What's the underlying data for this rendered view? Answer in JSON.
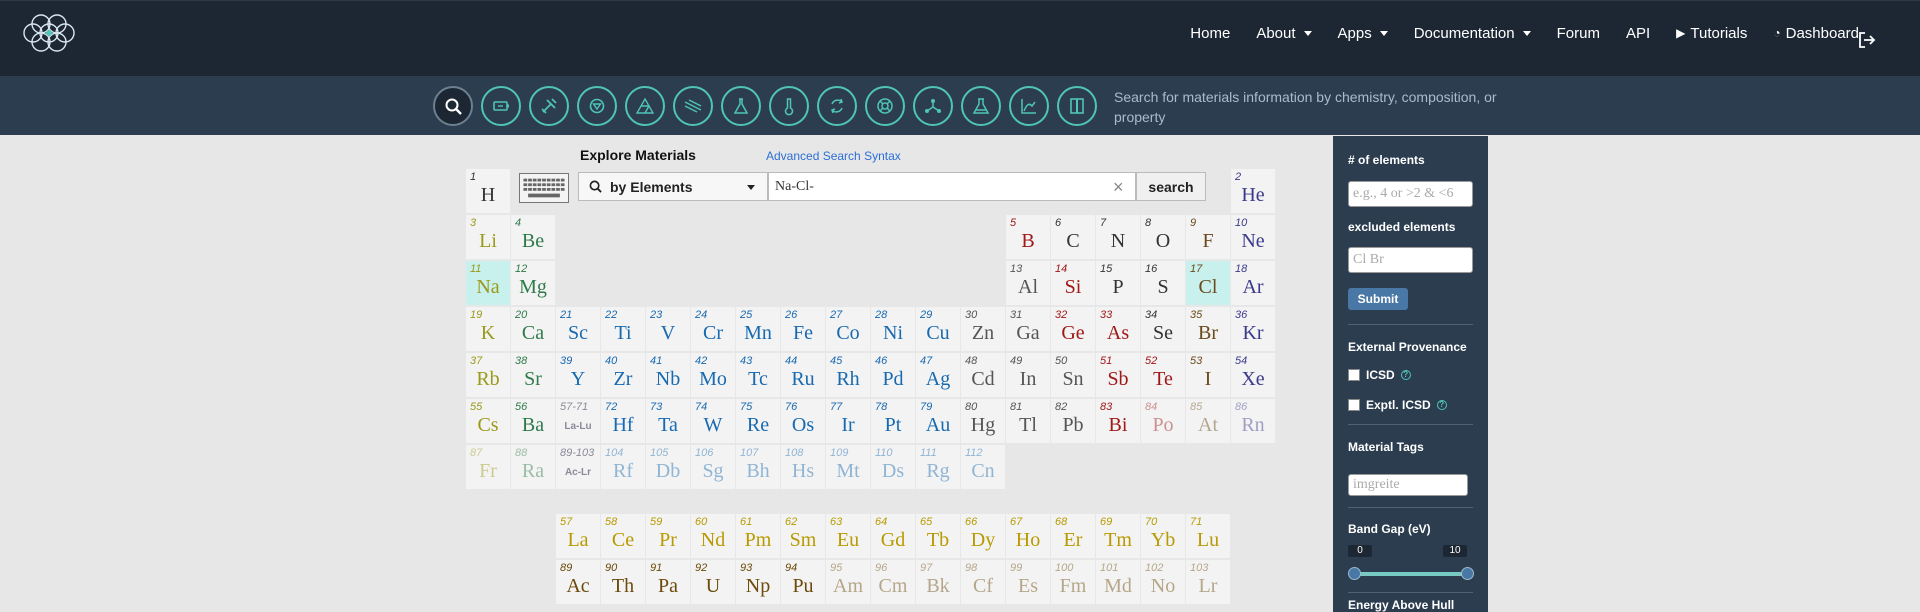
{
  "nav": {
    "items": [
      {
        "label": "Home",
        "caret": false,
        "icon": ""
      },
      {
        "label": "About",
        "caret": true,
        "icon": ""
      },
      {
        "label": "Apps",
        "caret": true,
        "icon": ""
      },
      {
        "label": "Documentation",
        "caret": true,
        "icon": ""
      },
      {
        "label": "Forum",
        "caret": false,
        "icon": ""
      },
      {
        "label": "API",
        "caret": false,
        "icon": ""
      },
      {
        "label": "Tutorials",
        "caret": false,
        "icon": "youtube-icon"
      },
      {
        "label": "Dashboard",
        "caret": false,
        "icon": "dashboard-icon"
      }
    ]
  },
  "toolbar": {
    "tools": [
      "search-icon",
      "battery-icon",
      "tools-icon",
      "shield-icon",
      "triangle-diagram-icon",
      "wave-icon",
      "flask-icon",
      "thermometer-icon",
      "cycle-icon",
      "lifebuoy-icon",
      "molecule-icon",
      "beaker-icon",
      "phase-plot-icon",
      "book-icon"
    ],
    "description": "Search for materials information by chemistry, composition, or property"
  },
  "explore": {
    "title": "Explore Materials",
    "advanced_link": "Advanced Search Syntax",
    "search_by": "by Elements",
    "query": "Na-Cl-",
    "search_button": "search"
  },
  "colors": {
    "nav_bg": "#1c2733",
    "toolbar_bg": "#2b3d4f",
    "accent": "#4fc4b8",
    "selected_element": "#c8f0ec",
    "submit": "#4a78a6"
  },
  "elements": [
    {
      "n": "1",
      "s": "H",
      "row": 1,
      "col": 1,
      "c": "nonmetal"
    },
    {
      "n": "2",
      "s": "He",
      "row": 1,
      "col": 18,
      "c": "noble"
    },
    {
      "n": "3",
      "s": "Li",
      "row": 2,
      "col": 1,
      "c": "alkali"
    },
    {
      "n": "4",
      "s": "Be",
      "row": 2,
      "col": 2,
      "c": "alkearth"
    },
    {
      "n": "5",
      "s": "B",
      "row": 2,
      "col": 13,
      "c": "metalloid"
    },
    {
      "n": "6",
      "s": "C",
      "row": 2,
      "col": 14,
      "c": "nonmetal"
    },
    {
      "n": "7",
      "s": "N",
      "row": 2,
      "col": 15,
      "c": "nonmetal"
    },
    {
      "n": "8",
      "s": "O",
      "row": 2,
      "col": 16,
      "c": "nonmetal"
    },
    {
      "n": "9",
      "s": "F",
      "row": 2,
      "col": 17,
      "c": "halogen"
    },
    {
      "n": "10",
      "s": "Ne",
      "row": 2,
      "col": 18,
      "c": "noble"
    },
    {
      "n": "11",
      "s": "Na",
      "row": 3,
      "col": 1,
      "c": "alkali",
      "sel": true
    },
    {
      "n": "12",
      "s": "Mg",
      "row": 3,
      "col": 2,
      "c": "alkearth"
    },
    {
      "n": "13",
      "s": "Al",
      "row": 3,
      "col": 13,
      "c": "post"
    },
    {
      "n": "14",
      "s": "Si",
      "row": 3,
      "col": 14,
      "c": "metalloid"
    },
    {
      "n": "15",
      "s": "P",
      "row": 3,
      "col": 15,
      "c": "nonmetal"
    },
    {
      "n": "16",
      "s": "S",
      "row": 3,
      "col": 16,
      "c": "nonmetal"
    },
    {
      "n": "17",
      "s": "Cl",
      "row": 3,
      "col": 17,
      "c": "halogen",
      "sel": true
    },
    {
      "n": "18",
      "s": "Ar",
      "row": 3,
      "col": 18,
      "c": "noble"
    },
    {
      "n": "19",
      "s": "K",
      "row": 4,
      "col": 1,
      "c": "alkali"
    },
    {
      "n": "20",
      "s": "Ca",
      "row": 4,
      "col": 2,
      "c": "alkearth"
    },
    {
      "n": "21",
      "s": "Sc",
      "row": 4,
      "col": 3,
      "c": "trans"
    },
    {
      "n": "22",
      "s": "Ti",
      "row": 4,
      "col": 4,
      "c": "trans"
    },
    {
      "n": "23",
      "s": "V",
      "row": 4,
      "col": 5,
      "c": "trans"
    },
    {
      "n": "24",
      "s": "Cr",
      "row": 4,
      "col": 6,
      "c": "trans"
    },
    {
      "n": "25",
      "s": "Mn",
      "row": 4,
      "col": 7,
      "c": "trans"
    },
    {
      "n": "26",
      "s": "Fe",
      "row": 4,
      "col": 8,
      "c": "trans"
    },
    {
      "n": "27",
      "s": "Co",
      "row": 4,
      "col": 9,
      "c": "trans"
    },
    {
      "n": "28",
      "s": "Ni",
      "row": 4,
      "col": 10,
      "c": "trans"
    },
    {
      "n": "29",
      "s": "Cu",
      "row": 4,
      "col": 11,
      "c": "trans"
    },
    {
      "n": "30",
      "s": "Zn",
      "row": 4,
      "col": 12,
      "c": "post"
    },
    {
      "n": "31",
      "s": "Ga",
      "row": 4,
      "col": 13,
      "c": "post"
    },
    {
      "n": "32",
      "s": "Ge",
      "row": 4,
      "col": 14,
      "c": "metalloid"
    },
    {
      "n": "33",
      "s": "As",
      "row": 4,
      "col": 15,
      "c": "metalloid"
    },
    {
      "n": "34",
      "s": "Se",
      "row": 4,
      "col": 16,
      "c": "nonmetal"
    },
    {
      "n": "35",
      "s": "Br",
      "row": 4,
      "col": 17,
      "c": "halogen"
    },
    {
      "n": "36",
      "s": "Kr",
      "row": 4,
      "col": 18,
      "c": "noble"
    },
    {
      "n": "37",
      "s": "Rb",
      "row": 5,
      "col": 1,
      "c": "alkali"
    },
    {
      "n": "38",
      "s": "Sr",
      "row": 5,
      "col": 2,
      "c": "alkearth"
    },
    {
      "n": "39",
      "s": "Y",
      "row": 5,
      "col": 3,
      "c": "trans"
    },
    {
      "n": "40",
      "s": "Zr",
      "row": 5,
      "col": 4,
      "c": "trans"
    },
    {
      "n": "41",
      "s": "Nb",
      "row": 5,
      "col": 5,
      "c": "trans"
    },
    {
      "n": "42",
      "s": "Mo",
      "row": 5,
      "col": 6,
      "c": "trans"
    },
    {
      "n": "43",
      "s": "Tc",
      "row": 5,
      "col": 7,
      "c": "trans"
    },
    {
      "n": "44",
      "s": "Ru",
      "row": 5,
      "col": 8,
      "c": "trans"
    },
    {
      "n": "45",
      "s": "Rh",
      "row": 5,
      "col": 9,
      "c": "trans"
    },
    {
      "n": "46",
      "s": "Pd",
      "row": 5,
      "col": 10,
      "c": "trans"
    },
    {
      "n": "47",
      "s": "Ag",
      "row": 5,
      "col": 11,
      "c": "trans"
    },
    {
      "n": "48",
      "s": "Cd",
      "row": 5,
      "col": 12,
      "c": "post"
    },
    {
      "n": "49",
      "s": "In",
      "row": 5,
      "col": 13,
      "c": "post"
    },
    {
      "n": "50",
      "s": "Sn",
      "row": 5,
      "col": 14,
      "c": "post"
    },
    {
      "n": "51",
      "s": "Sb",
      "row": 5,
      "col": 15,
      "c": "metalloid"
    },
    {
      "n": "52",
      "s": "Te",
      "row": 5,
      "col": 16,
      "c": "metalloid"
    },
    {
      "n": "53",
      "s": "I",
      "row": 5,
      "col": 17,
      "c": "halogen"
    },
    {
      "n": "54",
      "s": "Xe",
      "row": 5,
      "col": 18,
      "c": "noble"
    },
    {
      "n": "55",
      "s": "Cs",
      "row": 6,
      "col": 1,
      "c": "alkali"
    },
    {
      "n": "56",
      "s": "Ba",
      "row": 6,
      "col": 2,
      "c": "alkearth"
    },
    {
      "n": "57-71",
      "s": "La-Lu",
      "row": 6,
      "col": 3,
      "c": "ph",
      "small": true
    },
    {
      "n": "72",
      "s": "Hf",
      "row": 6,
      "col": 4,
      "c": "trans"
    },
    {
      "n": "73",
      "s": "Ta",
      "row": 6,
      "col": 5,
      "c": "trans"
    },
    {
      "n": "74",
      "s": "W",
      "row": 6,
      "col": 6,
      "c": "trans"
    },
    {
      "n": "75",
      "s": "Re",
      "row": 6,
      "col": 7,
      "c": "trans"
    },
    {
      "n": "76",
      "s": "Os",
      "row": 6,
      "col": 8,
      "c": "trans"
    },
    {
      "n": "77",
      "s": "Ir",
      "row": 6,
      "col": 9,
      "c": "trans"
    },
    {
      "n": "78",
      "s": "Pt",
      "row": 6,
      "col": 10,
      "c": "trans"
    },
    {
      "n": "79",
      "s": "Au",
      "row": 6,
      "col": 11,
      "c": "trans"
    },
    {
      "n": "80",
      "s": "Hg",
      "row": 6,
      "col": 12,
      "c": "post"
    },
    {
      "n": "81",
      "s": "Tl",
      "row": 6,
      "col": 13,
      "c": "post"
    },
    {
      "n": "82",
      "s": "Pb",
      "row": 6,
      "col": 14,
      "c": "post"
    },
    {
      "n": "83",
      "s": "Bi",
      "row": 6,
      "col": 15,
      "c": "metalloid"
    },
    {
      "n": "84",
      "s": "Po",
      "row": 6,
      "col": 16,
      "c": "metalloid",
      "faded": true
    },
    {
      "n": "85",
      "s": "At",
      "row": 6,
      "col": 17,
      "c": "halogen",
      "faded": true
    },
    {
      "n": "86",
      "s": "Rn",
      "row": 6,
      "col": 18,
      "c": "noble",
      "faded": true
    },
    {
      "n": "87",
      "s": "Fr",
      "row": 7,
      "col": 1,
      "c": "alkali",
      "faded": true
    },
    {
      "n": "88",
      "s": "Ra",
      "row": 7,
      "col": 2,
      "c": "alkearth",
      "faded": true
    },
    {
      "n": "89-103",
      "s": "Ac-Lr",
      "row": 7,
      "col": 3,
      "c": "ph",
      "small": true
    },
    {
      "n": "104",
      "s": "Rf",
      "row": 7,
      "col": 4,
      "c": "trans",
      "faded": true
    },
    {
      "n": "105",
      "s": "Db",
      "row": 7,
      "col": 5,
      "c": "trans",
      "faded": true
    },
    {
      "n": "106",
      "s": "Sg",
      "row": 7,
      "col": 6,
      "c": "trans",
      "faded": true
    },
    {
      "n": "107",
      "s": "Bh",
      "row": 7,
      "col": 7,
      "c": "trans",
      "faded": true
    },
    {
      "n": "108",
      "s": "Hs",
      "row": 7,
      "col": 8,
      "c": "trans",
      "faded": true
    },
    {
      "n": "109",
      "s": "Mt",
      "row": 7,
      "col": 9,
      "c": "trans",
      "faded": true
    },
    {
      "n": "110",
      "s": "Ds",
      "row": 7,
      "col": 10,
      "c": "trans",
      "faded": true
    },
    {
      "n": "111",
      "s": "Rg",
      "row": 7,
      "col": 11,
      "c": "trans",
      "faded": true
    },
    {
      "n": "112",
      "s": "Cn",
      "row": 7,
      "col": 12,
      "c": "trans",
      "faded": true
    },
    {
      "n": "57",
      "s": "La",
      "row": 8,
      "col": 3,
      "c": "lanth"
    },
    {
      "n": "58",
      "s": "Ce",
      "row": 8,
      "col": 4,
      "c": "lanth"
    },
    {
      "n": "59",
      "s": "Pr",
      "row": 8,
      "col": 5,
      "c": "lanth"
    },
    {
      "n": "60",
      "s": "Nd",
      "row": 8,
      "col": 6,
      "c": "lanth"
    },
    {
      "n": "61",
      "s": "Pm",
      "row": 8,
      "col": 7,
      "c": "lanth"
    },
    {
      "n": "62",
      "s": "Sm",
      "row": 8,
      "col": 8,
      "c": "lanth"
    },
    {
      "n": "63",
      "s": "Eu",
      "row": 8,
      "col": 9,
      "c": "lanth"
    },
    {
      "n": "64",
      "s": "Gd",
      "row": 8,
      "col": 10,
      "c": "lanth"
    },
    {
      "n": "65",
      "s": "Tb",
      "row": 8,
      "col": 11,
      "c": "lanth"
    },
    {
      "n": "66",
      "s": "Dy",
      "row": 8,
      "col": 12,
      "c": "lanth"
    },
    {
      "n": "67",
      "s": "Ho",
      "row": 8,
      "col": 13,
      "c": "lanth"
    },
    {
      "n": "68",
      "s": "Er",
      "row": 8,
      "col": 14,
      "c": "lanth"
    },
    {
      "n": "69",
      "s": "Tm",
      "row": 8,
      "col": 15,
      "c": "lanth"
    },
    {
      "n": "70",
      "s": "Yb",
      "row": 8,
      "col": 16,
      "c": "lanth"
    },
    {
      "n": "71",
      "s": "Lu",
      "row": 8,
      "col": 17,
      "c": "lanth"
    },
    {
      "n": "89",
      "s": "Ac",
      "row": 9,
      "col": 3,
      "c": "act"
    },
    {
      "n": "90",
      "s": "Th",
      "row": 9,
      "col": 4,
      "c": "act"
    },
    {
      "n": "91",
      "s": "Pa",
      "row": 9,
      "col": 5,
      "c": "act"
    },
    {
      "n": "92",
      "s": "U",
      "row": 9,
      "col": 6,
      "c": "act"
    },
    {
      "n": "93",
      "s": "Np",
      "row": 9,
      "col": 7,
      "c": "act"
    },
    {
      "n": "94",
      "s": "Pu",
      "row": 9,
      "col": 8,
      "c": "act"
    },
    {
      "n": "95",
      "s": "Am",
      "row": 9,
      "col": 9,
      "c": "act",
      "faded": true
    },
    {
      "n": "96",
      "s": "Cm",
      "row": 9,
      "col": 10,
      "c": "act",
      "faded": true
    },
    {
      "n": "97",
      "s": "Bk",
      "row": 9,
      "col": 11,
      "c": "act",
      "faded": true
    },
    {
      "n": "98",
      "s": "Cf",
      "row": 9,
      "col": 12,
      "c": "act",
      "faded": true
    },
    {
      "n": "99",
      "s": "Es",
      "row": 9,
      "col": 13,
      "c": "act",
      "faded": true
    },
    {
      "n": "100",
      "s": "Fm",
      "row": 9,
      "col": 14,
      "c": "act",
      "faded": true
    },
    {
      "n": "101",
      "s": "Md",
      "row": 9,
      "col": 15,
      "c": "act",
      "faded": true
    },
    {
      "n": "102",
      "s": "No",
      "row": 9,
      "col": 16,
      "c": "act",
      "faded": true
    },
    {
      "n": "103",
      "s": "Lr",
      "row": 9,
      "col": 17,
      "c": "act",
      "faded": true
    }
  ],
  "sidebar": {
    "num_elements_label": "# of elements",
    "num_elements_placeholder": "e.g., 4 or >2 & <6",
    "excluded_label": "excluded elements",
    "excluded_placeholder": "Cl Br",
    "submit": "Submit",
    "provenance_label": "External Provenance",
    "icsd_label": "ICSD",
    "exptl_icsd_label": "Exptl. ICSD",
    "tags_label": "Material Tags",
    "tags_placeholder": "imgreite",
    "band_gap_label": "Band Gap (eV)",
    "band_gap_min": "0",
    "band_gap_max": "10",
    "ehull_label": "Energy Above Hull"
  }
}
